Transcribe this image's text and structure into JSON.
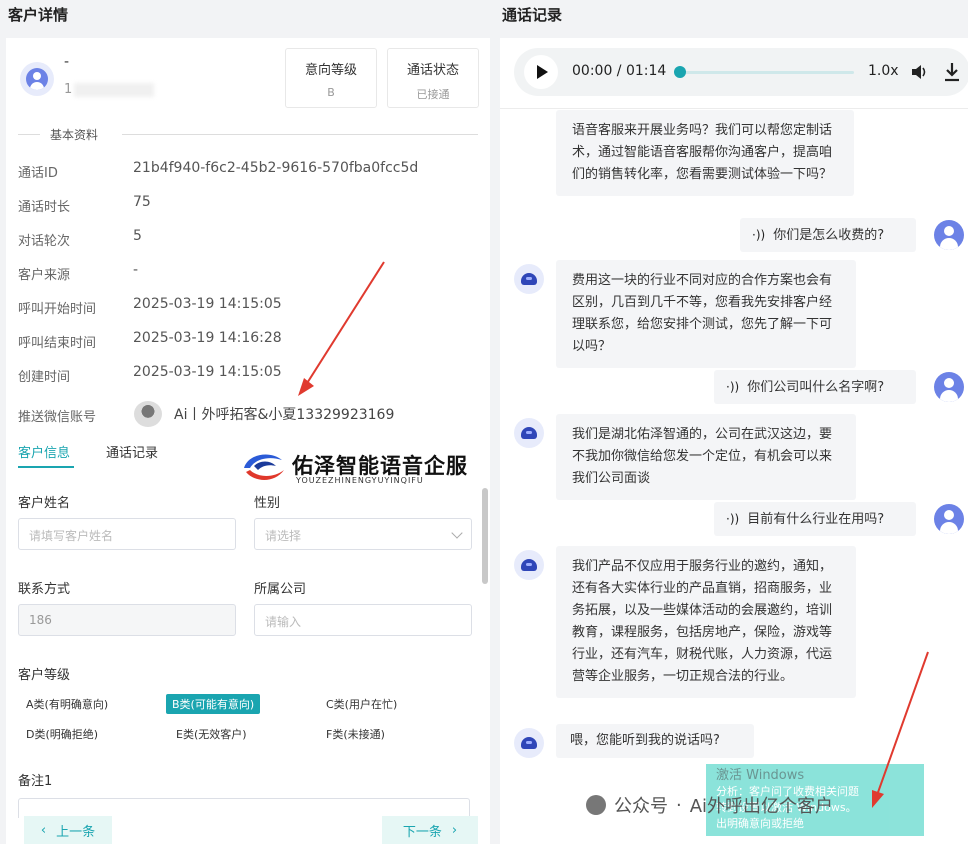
{
  "left_panel": {
    "title": "客户详情",
    "customer": {
      "name": "-",
      "phone_prefix": "1"
    },
    "stats": [
      {
        "label": "意向等级",
        "value": "B"
      },
      {
        "label": "通话状态",
        "value": "已接通"
      }
    ],
    "section_title": "基本资料",
    "info_rows": [
      {
        "key": "通话ID",
        "value": "21b4f940-f6c2-45b2-9616-570fba0fcc5d"
      },
      {
        "key": "通话时长",
        "value": "75"
      },
      {
        "key": "对话轮次",
        "value": "5"
      },
      {
        "key": "客户来源",
        "value": "-"
      },
      {
        "key": "呼叫开始时间",
        "value": "2025-03-19 14:15:05"
      },
      {
        "key": "呼叫结束时间",
        "value": "2025-03-19 14:16:28"
      },
      {
        "key": "创建时间",
        "value": "2025-03-19 14:15:05"
      },
      {
        "key": "推送微信账号",
        "value": "Ai丨外呼拓客&小夏13329923169"
      }
    ],
    "tabs": [
      "客户信息",
      "通话记录"
    ],
    "brand": {
      "name": "佑泽智能语音企服",
      "pinyin": "YOUZEZHINENGYUYINQIFU"
    },
    "form": {
      "name_label": "客户姓名",
      "name_placeholder": "请填写客户姓名",
      "gender_label": "性别",
      "gender_placeholder": "请选择",
      "contact_label": "联系方式",
      "contact_value": "186",
      "company_label": "所属公司",
      "company_placeholder": "请输入",
      "level_label": "客户等级",
      "levels": [
        "A类(有明确意向)",
        "B类(可能有意向)",
        "C类(用户在忙)",
        "D类(明确拒绝)",
        "E类(无效客户)",
        "F类(未接通)"
      ],
      "selected_level": "B类(可能有意向)",
      "remark_label": "备注1"
    },
    "nav": {
      "prev": "上一条",
      "next": "下一条"
    }
  },
  "right_panel": {
    "title": "通话记录",
    "player": {
      "current": "00:00",
      "total": "01:14",
      "time_text": "00:00 / 01:14",
      "speed": "1.0x",
      "progress": 0
    },
    "messages": [
      {
        "role": "bot",
        "text": "语音客服来开展业务吗？我们可以帮您定制话术，通过智能语音客服帮你沟通客户，提高咱们的销售转化率，您看需要测试体验一下吗？"
      },
      {
        "role": "user",
        "text": "你们是怎么收费的?"
      },
      {
        "role": "bot",
        "text": "费用这一块的行业不同对应的合作方案也会有区别，几百到几千不等，您看我先安排客户经理联系您，给您安排个测试，您先了解一下可以吗？"
      },
      {
        "role": "user",
        "text": "你们公司叫什么名字啊?"
      },
      {
        "role": "bot",
        "text": "我们是湖北佑泽智通的，公司在武汉这边，要不我加你微信给您发一个定位，有机会可以来我们公司面谈"
      },
      {
        "role": "user",
        "text": "目前有什么行业在用吗?"
      },
      {
        "role": "bot",
        "text": "我们产品不仅应用于服务行业的邀约，通知，还有各大实体行业的产品直销，招商服务，业务拓展，以及一些媒体活动的会展邀约，培训教育，课程服务，包括房地产，保险，游戏等行业，还有汽车，财税代账，人力资源，代运营等企业服务，一切正规合法的行业。"
      },
      {
        "role": "bot",
        "text": "喂，您能听到我的说话吗?"
      }
    ],
    "popup": {
      "title": "激活 Windows",
      "lines": [
        "分析：客户问了收费相关问题",
        "转到设置以激活 Windows。",
        "出明确意向或拒绝"
      ]
    }
  },
  "watermark": {
    "prefix": "公众号",
    "name": "Ai外呼出亿个客户"
  },
  "colors": {
    "accent": "#1aa5b0",
    "arrow": "#e03a2f",
    "brand_avatar": "#6c82e6"
  }
}
